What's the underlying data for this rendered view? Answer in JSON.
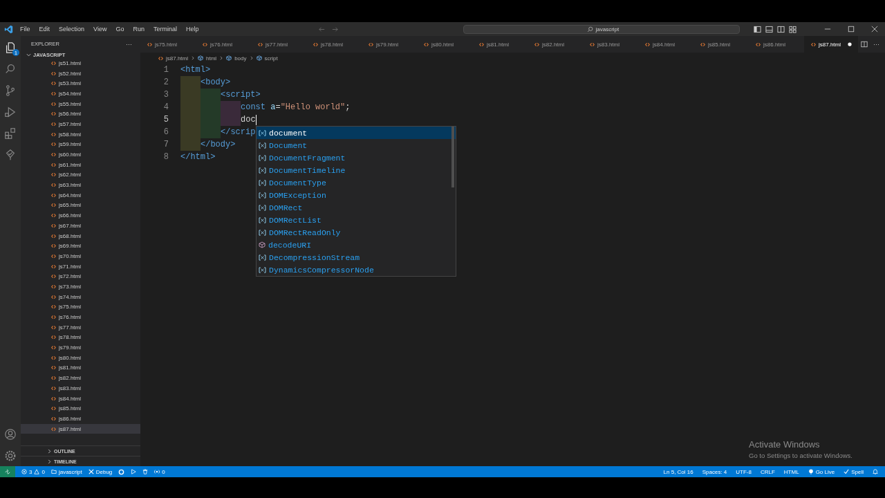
{
  "menu": [
    "File",
    "Edit",
    "Selection",
    "View",
    "Go",
    "Run",
    "Terminal",
    "Help"
  ],
  "search": {
    "value": "javascript"
  },
  "activity": {
    "badge": "1"
  },
  "sidebar": {
    "title": "EXPLORER",
    "more": "···",
    "folder": "JAVASCRIPT",
    "files": [
      {
        "name": "js51.html",
        "selected": false
      },
      {
        "name": "js52.html",
        "selected": false
      },
      {
        "name": "js53.html",
        "selected": false
      },
      {
        "name": "js54.html",
        "selected": false
      },
      {
        "name": "js55.html",
        "selected": false
      },
      {
        "name": "js56.html",
        "selected": false
      },
      {
        "name": "js57.html",
        "selected": false
      },
      {
        "name": "js58.html",
        "selected": false
      },
      {
        "name": "js59.html",
        "selected": false
      },
      {
        "name": "js60.html",
        "selected": false
      },
      {
        "name": "js61.html",
        "selected": false
      },
      {
        "name": "js62.html",
        "selected": false
      },
      {
        "name": "js63.html",
        "selected": false
      },
      {
        "name": "js64.html",
        "selected": false
      },
      {
        "name": "js65.html",
        "selected": false
      },
      {
        "name": "js66.html",
        "selected": false
      },
      {
        "name": "js67.html",
        "selected": false
      },
      {
        "name": "js68.html",
        "selected": false
      },
      {
        "name": "js69.html",
        "selected": false
      },
      {
        "name": "js70.html",
        "selected": false
      },
      {
        "name": "js71.html",
        "selected": false
      },
      {
        "name": "js72.html",
        "selected": false
      },
      {
        "name": "js73.html",
        "selected": false
      },
      {
        "name": "js74.html",
        "selected": false
      },
      {
        "name": "js75.html",
        "selected": false
      },
      {
        "name": "js76.html",
        "selected": false
      },
      {
        "name": "js77.html",
        "selected": false
      },
      {
        "name": "js78.html",
        "selected": false
      },
      {
        "name": "js79.html",
        "selected": false
      },
      {
        "name": "js80.html",
        "selected": false
      },
      {
        "name": "js81.html",
        "selected": false
      },
      {
        "name": "js82.html",
        "selected": false
      },
      {
        "name": "js83.html",
        "selected": false
      },
      {
        "name": "js84.html",
        "selected": false
      },
      {
        "name": "js85.html",
        "selected": false
      },
      {
        "name": "js86.html",
        "selected": false
      },
      {
        "name": "js87.html",
        "selected": true
      }
    ],
    "sections": [
      "OUTLINE",
      "TIMELINE"
    ]
  },
  "tabs": [
    {
      "label": "js75.html",
      "selected": false,
      "dirty": false
    },
    {
      "label": "js76.html",
      "selected": false,
      "dirty": false
    },
    {
      "label": "js77.html",
      "selected": false,
      "dirty": false
    },
    {
      "label": "js78.html",
      "selected": false,
      "dirty": false
    },
    {
      "label": "js79.html",
      "selected": false,
      "dirty": false
    },
    {
      "label": "js80.html",
      "selected": false,
      "dirty": false
    },
    {
      "label": "js81.html",
      "selected": false,
      "dirty": false
    },
    {
      "label": "js82.html",
      "selected": false,
      "dirty": false
    },
    {
      "label": "js83.html",
      "selected": false,
      "dirty": false
    },
    {
      "label": "js84.html",
      "selected": false,
      "dirty": false
    },
    {
      "label": "js85.html",
      "selected": false,
      "dirty": false
    },
    {
      "label": "js86.html",
      "selected": false,
      "dirty": false
    },
    {
      "label": "js87.html",
      "selected": true,
      "dirty": true
    }
  ],
  "tab_more": "···",
  "breadcrumb": [
    {
      "label": "js87.html",
      "kind": "file"
    },
    {
      "label": "html",
      "kind": "symbol"
    },
    {
      "label": "body",
      "kind": "symbol"
    },
    {
      "label": "script",
      "kind": "symbol"
    }
  ],
  "code": [
    {
      "number": "1",
      "tokens": [
        {
          "text": "<html>",
          "kind": "tag"
        }
      ],
      "children": [
        {
          "number": "2",
          "tokens": [
            {
              "text": "<body>",
              "kind": "tag"
            }
          ],
          "children": [
            {
              "number": "3",
              "tokens": [
                {
                  "text": "<script>",
                  "kind": "tag"
                }
              ],
              "children": [
                {
                  "number": "4",
                  "tokens": [
                    {
                      "text": "const ",
                      "kind": "keyword"
                    },
                    {
                      "text": "a",
                      "kind": "variable"
                    },
                    {
                      "text": "=",
                      "kind": "plain"
                    },
                    {
                      "text": "\"Hello world\"",
                      "kind": "string"
                    },
                    {
                      "text": ";",
                      "kind": "plain"
                    }
                  ]
                },
                {
                  "number": "5",
                  "tokens": [
                    {
                      "text": "doc",
                      "kind": "plain"
                    }
                  ],
                  "cursor": true
                }
              ]
            },
            {
              "number": "6",
              "tokens": [
                {
                  "text": "</scrip",
                  "kind": "tag"
                }
              ]
            }
          ]
        },
        {
          "number": "7",
          "tokens": [
            {
              "text": "</body>",
              "kind": "tag"
            }
          ]
        }
      ]
    },
    {
      "number": "8",
      "tokens": [
        {
          "text": "</html>",
          "kind": "tag"
        }
      ]
    }
  ],
  "suggestions": [
    {
      "label": "document",
      "kind": "variable",
      "selected": true
    },
    {
      "label": "Document",
      "kind": "variable",
      "selected": false
    },
    {
      "label": "DocumentFragment",
      "kind": "variable",
      "selected": false
    },
    {
      "label": "DocumentTimeline",
      "kind": "variable",
      "selected": false
    },
    {
      "label": "DocumentType",
      "kind": "variable",
      "selected": false
    },
    {
      "label": "DOMException",
      "kind": "variable",
      "selected": false
    },
    {
      "label": "DOMRect",
      "kind": "variable",
      "selected": false
    },
    {
      "label": "DOMRectList",
      "kind": "variable",
      "selected": false
    },
    {
      "label": "DOMRectReadOnly",
      "kind": "variable",
      "selected": false
    },
    {
      "label": "decodeURI",
      "kind": "function",
      "selected": false
    },
    {
      "label": "DecompressionStream",
      "kind": "variable",
      "selected": false
    },
    {
      "label": "DynamicsCompressorNode",
      "kind": "variable",
      "selected": false
    }
  ],
  "activation": {
    "title": "Activate Windows",
    "text": "Go to Settings to activate Windows."
  },
  "status_bar": {
    "errors": "3",
    "warnings": "0",
    "project": "javascript",
    "debug": "Debug",
    "ports": "0",
    "right": [
      {
        "text": "Ln 5, Col 16",
        "kind": "plain"
      },
      {
        "text": "Spaces: 4",
        "kind": "plain"
      },
      {
        "text": "UTF-8",
        "kind": "plain"
      },
      {
        "text": "CRLF",
        "kind": "plain"
      },
      {
        "text": "HTML",
        "kind": "plain"
      },
      {
        "text": "Go Live",
        "kind": "live"
      },
      {
        "text": "Spell",
        "kind": "check"
      }
    ]
  }
}
